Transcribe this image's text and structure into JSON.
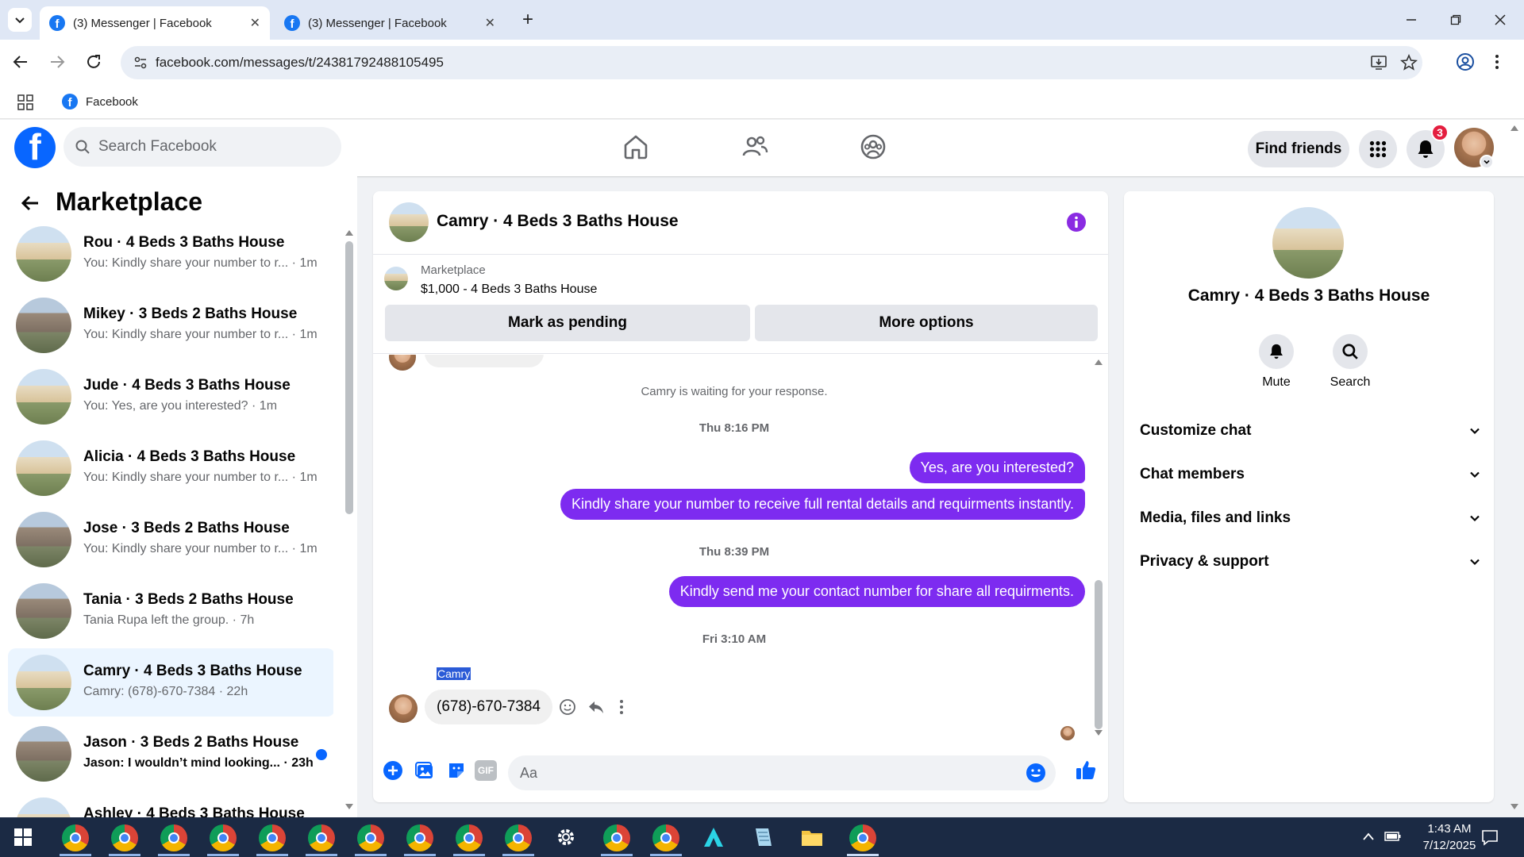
{
  "browser": {
    "tabs": [
      {
        "title": "(3) Messenger | Facebook",
        "favicon": "facebook-favicon-icon"
      },
      {
        "title": "(3) Messenger | Facebook",
        "favicon": "facebook-favicon-icon"
      }
    ],
    "url": "facebook.com/messages/t/24381792488105495",
    "bookmark_label": "Facebook",
    "favicon_letter": "f"
  },
  "facebook": {
    "logo_letter": "f",
    "search_placeholder": "Search Facebook",
    "find_friends_label": "Find friends",
    "notification_count": "3"
  },
  "sidebar": {
    "title": "Marketplace",
    "conversations": [
      {
        "title": "Rou · 4 Beds 3 Baths House",
        "subtitle": "You: Kindly share your number to r... · 1m",
        "avatar": "house-yellow"
      },
      {
        "title": "Mikey · 3 Beds 2 Baths House",
        "subtitle": "You: Kindly share your number to r... · 1m",
        "avatar": "house-grey"
      },
      {
        "title": "Jude · 4 Beds 3 Baths House",
        "subtitle": "You: Yes, are you interested? · 1m",
        "avatar": "house-yellow"
      },
      {
        "title": "Alicia · 4 Beds 3 Baths House",
        "subtitle": "You: Kindly share your number to r... · 1m",
        "avatar": "house-yellow"
      },
      {
        "title": "Jose · 3 Beds 2 Baths House",
        "subtitle": "You: Kindly share your number to r... · 1m",
        "avatar": "house-grey"
      },
      {
        "title": "Tania · 3 Beds 2 Baths House",
        "subtitle": "Tania Rupa left the group. · 7h",
        "avatar": "house-grey"
      },
      {
        "title": "Camry · 4 Beds 3 Baths House",
        "subtitle": "Camry: (678)-670-7384 · 22h",
        "avatar": "house-yellow",
        "selected": true
      },
      {
        "title": "Jason · 3 Beds 2 Baths House",
        "subtitle": "Jason: I wouldn’t mind looking... · 23h",
        "avatar": "house-grey",
        "unread": true
      },
      {
        "title": "Ashley · 4 Beds 3 Baths House",
        "subtitle": "",
        "avatar": "house-yellow"
      }
    ]
  },
  "chat": {
    "title": "Camry · 4 Beds 3 Baths House",
    "listing_source": "Marketplace",
    "listing_price_title": "$1,000 - 4 Beds 3 Baths House",
    "mark_pending_label": "Mark as pending",
    "more_options_label": "More options",
    "waiting_notice": "Camry is waiting for your response.",
    "timestamp_1": "Thu 8:16 PM",
    "outgoing_1": "Yes, are you interested?",
    "outgoing_2": "Kindly share your number to receive full rental details and requirments instantly.",
    "timestamp_2": "Thu 8:39 PM",
    "outgoing_3": "Kindly send me your contact number for share all requirments.",
    "timestamp_3": "Fri 3:10 AM",
    "sender_name": "Camry",
    "incoming_1": "(678)-670-7384",
    "composer_placeholder": "Aa",
    "gif_label": "GIF"
  },
  "info_panel": {
    "title": "Camry · 4 Beds 3 Baths House",
    "mute_label": "Mute",
    "search_label": "Search",
    "sections": [
      "Customize chat",
      "Chat members",
      "Media, files and links",
      "Privacy & support"
    ]
  },
  "taskbar": {
    "time": "1:43 AM",
    "date": "7/12/2025"
  },
  "colors": {
    "facebook_blue": "#0866ff",
    "messenger_purple": "#7d2bf0",
    "notification_red": "#e41e3f",
    "selected_row": "#ebf5ff"
  }
}
